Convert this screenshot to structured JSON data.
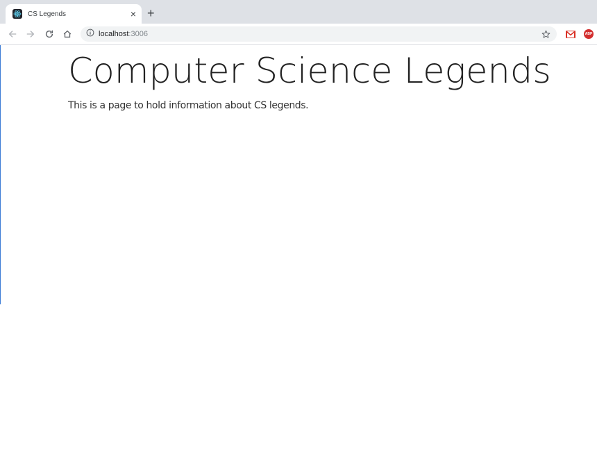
{
  "browser": {
    "tab": {
      "title": "CS Legends",
      "close_label": "×"
    },
    "new_tab_label": "+",
    "address": {
      "host": "localhost",
      "port": ":3006"
    },
    "icons": {
      "favicon": "react-atom-icon",
      "back": "arrow-left-icon",
      "forward": "arrow-right-icon",
      "reload": "reload-icon",
      "home": "home-icon",
      "info": "info-icon",
      "bookmark": "star-icon",
      "gmail": "gmail-icon",
      "adblock": "adblock-plus-icon"
    },
    "adblock_label": "ABP",
    "colors": {
      "tabstrip": "#dee1e6",
      "omnibox": "#f1f3f4",
      "gmail_red": "#d93025",
      "adblock_red": "#d32f2f"
    }
  },
  "page": {
    "title": "Computer Science Legends",
    "lead": "This is a page to hold information about CS legends."
  }
}
